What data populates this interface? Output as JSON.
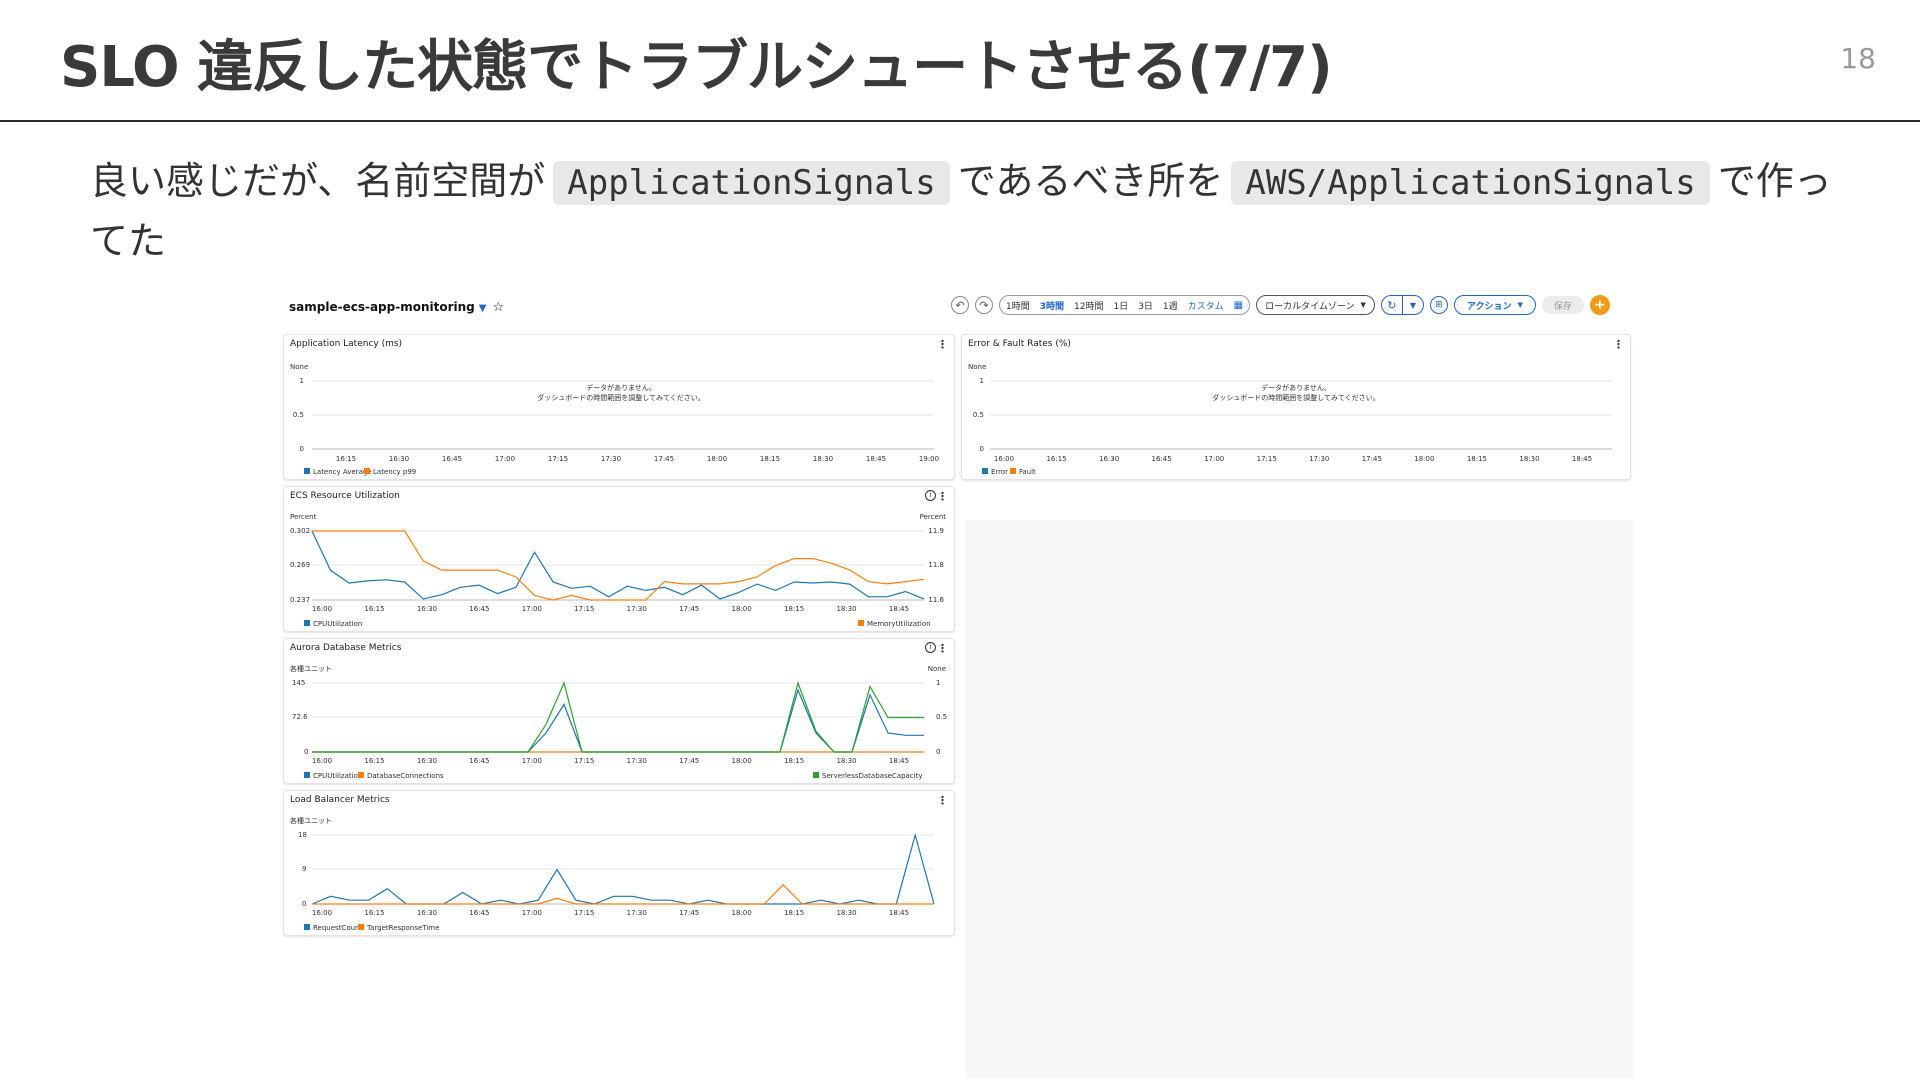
{
  "slide": {
    "title": "SLO 違反した状態でトラブルシュートさせる(7/7)",
    "page_number": "18",
    "text_before_code1": "良い感じだが、名前空間が",
    "code1": "ApplicationSignals",
    "text_between": "であるべき所を",
    "code2": "AWS/ApplicationSignals",
    "text_after": "で作ってた"
  },
  "dashboard": {
    "name": "sample-ecs-app-monitoring",
    "caret": "▼",
    "star": "☆",
    "undo_icon": "undo-icon",
    "redo_icon": "redo-icon",
    "time_ranges": [
      "1時間",
      "3時間",
      "12時間",
      "1日",
      "3日",
      "1週",
      "カスタム"
    ],
    "active_range": "3時間",
    "timezone": "ローカルタイムゾーン",
    "actions_label": "アクション",
    "save_label": "保存",
    "add_label": "+",
    "colors": {
      "blue": "#1f77b4",
      "orange": "#ff7f0e",
      "green": "#2ca02c",
      "accent": "#1f66c9",
      "add": "#f29b16"
    }
  },
  "widgets": {
    "latency": {
      "title": "Application Latency (ms)",
      "unit": "None",
      "y_ticks": [
        "1",
        "0.5",
        "0"
      ],
      "x_ticks": [
        "16:15",
        "16:30",
        "16:45",
        "17:00",
        "17:15",
        "17:30",
        "17:45",
        "18:00",
        "18:15",
        "18:30",
        "18:45",
        "19:00"
      ],
      "empty_line1": "データがありません。",
      "empty_line2": "ダッシュボードの時間範囲を調整してみてください。",
      "legend": [
        "Latency Average",
        "Latency p99"
      ]
    },
    "errors": {
      "title": "Error & Fault Rates (%)",
      "unit": "None",
      "y_ticks": [
        "1",
        "0.5",
        "0"
      ],
      "x_ticks": [
        "16:00",
        "16:15",
        "16:30",
        "16:45",
        "17:00",
        "17:15",
        "17:30",
        "17:45",
        "18:00",
        "18:15",
        "18:30",
        "18:45"
      ],
      "empty_line1": "データがありません。",
      "empty_line2": "ダッシュボードの時間範囲を調整してみてください。",
      "legend": [
        "Error",
        "Fault"
      ]
    },
    "ecs": {
      "title": "ECS Resource Utilization",
      "left_unit": "Percent",
      "right_unit": "Percent",
      "y_ticks_left": [
        "0.302",
        "0.269",
        "0.237"
      ],
      "y_ticks_right": [
        "11.9",
        "11.8",
        "11.6"
      ],
      "x_ticks": [
        "16:00",
        "16:15",
        "16:30",
        "16:45",
        "17:00",
        "17:15",
        "17:30",
        "17:45",
        "18:00",
        "18:15",
        "18:30",
        "18:45"
      ],
      "legend_left": "CPUUtilization",
      "legend_right": "MemoryUtilization"
    },
    "aurora": {
      "title": "Aurora Database Metrics",
      "left_unit": "各種ユニット",
      "right_unit": "None",
      "y_ticks_left": [
        "145",
        "72.6",
        "0"
      ],
      "y_ticks_right": [
        "1",
        "0.5",
        "0"
      ],
      "x_ticks": [
        "16:00",
        "16:15",
        "16:30",
        "16:45",
        "17:00",
        "17:15",
        "17:30",
        "17:45",
        "18:00",
        "18:15",
        "18:30",
        "18:45"
      ],
      "legend_left": [
        "CPUUtilization",
        "DatabaseConnections"
      ],
      "legend_right": "ServerlessDatabaseCapacity"
    },
    "lb": {
      "title": "Load Balancer Metrics",
      "left_unit": "各種ユニット",
      "y_ticks": [
        "18",
        "9",
        "0"
      ],
      "x_ticks": [
        "16:00",
        "16:15",
        "16:30",
        "16:45",
        "17:00",
        "17:15",
        "17:30",
        "17:45",
        "18:00",
        "18:15",
        "18:30",
        "18:45"
      ],
      "legend": [
        "RequestCount",
        "TargetResponseTime"
      ]
    }
  },
  "chart_data": [
    {
      "type": "line",
      "title": "ECS Resource Utilization",
      "x": [
        "16:00",
        "16:05",
        "16:10",
        "16:15",
        "16:20",
        "16:25",
        "16:30",
        "16:35",
        "16:40",
        "16:45",
        "16:50",
        "16:55",
        "17:00",
        "17:05",
        "17:10",
        "17:15",
        "17:20",
        "17:25",
        "17:30",
        "17:35",
        "17:40",
        "17:45",
        "17:50",
        "17:55",
        "18:00",
        "18:05",
        "18:10",
        "18:15",
        "18:20",
        "18:25",
        "18:30",
        "18:35",
        "18:40",
        "18:45"
      ],
      "series": [
        {
          "name": "CPUUtilization",
          "axis": "left",
          "values": [
            0.302,
            0.265,
            0.253,
            0.255,
            0.256,
            0.254,
            0.238,
            0.242,
            0.249,
            0.251,
            0.243,
            0.249,
            0.282,
            0.254,
            0.248,
            0.25,
            0.24,
            0.25,
            0.246,
            0.249,
            0.242,
            0.251,
            0.238,
            0.244,
            0.252,
            0.246,
            0.254,
            0.253,
            0.254,
            0.252,
            0.24,
            0.24,
            0.245,
            0.238
          ]
        },
        {
          "name": "MemoryUtilization",
          "axis": "right",
          "values": [
            11.9,
            11.9,
            11.9,
            11.9,
            11.9,
            11.9,
            11.77,
            11.73,
            11.73,
            11.73,
            11.73,
            11.7,
            11.62,
            11.6,
            11.62,
            11.6,
            11.6,
            11.6,
            11.6,
            11.68,
            11.67,
            11.67,
            11.67,
            11.68,
            11.7,
            11.75,
            11.78,
            11.78,
            11.76,
            11.73,
            11.68,
            11.67,
            11.68,
            11.69
          ]
        }
      ],
      "ylim_left": [
        0.237,
        0.302
      ],
      "ylim_right": [
        11.6,
        11.9
      ]
    },
    {
      "type": "line",
      "title": "Aurora Database Metrics",
      "x": [
        "16:00",
        "16:05",
        "16:10",
        "16:15",
        "16:20",
        "16:25",
        "16:30",
        "16:35",
        "16:40",
        "16:45",
        "16:50",
        "16:55",
        "17:00",
        "17:05",
        "17:10",
        "17:15",
        "17:20",
        "17:25",
        "17:30",
        "17:35",
        "17:40",
        "17:45",
        "17:50",
        "17:55",
        "18:00",
        "18:05",
        "18:10",
        "18:15",
        "18:20",
        "18:25",
        "18:30",
        "18:35",
        "18:40",
        "18:45",
        "18:50"
      ],
      "series": [
        {
          "name": "CPUUtilization",
          "axis": "left",
          "values": [
            0,
            0,
            0,
            0,
            0,
            0,
            0,
            0,
            0,
            0,
            0,
            0,
            0,
            40,
            100,
            0,
            0,
            0,
            0,
            0,
            0,
            0,
            0,
            0,
            0,
            0,
            0,
            130,
            40,
            0,
            0,
            120,
            40,
            35,
            35
          ]
        },
        {
          "name": "DatabaseConnections",
          "axis": "left",
          "values": [
            0,
            0,
            0,
            0,
            0,
            0,
            0,
            0,
            0,
            0,
            0,
            0,
            0,
            0,
            0,
            0,
            0,
            0,
            0,
            0,
            0,
            0,
            0,
            0,
            0,
            0,
            0,
            0,
            0,
            0,
            0,
            0,
            0,
            0,
            0
          ]
        },
        {
          "name": "ServerlessDatabaseCapacity",
          "axis": "right",
          "values": [
            0,
            0,
            0,
            0,
            0,
            0,
            0,
            0,
            0,
            0,
            0,
            0,
            0,
            0.4,
            1.0,
            0,
            0,
            0,
            0,
            0,
            0,
            0,
            0,
            0,
            0,
            0,
            0,
            1.0,
            0.3,
            0,
            0,
            0.95,
            0.5,
            0.5,
            0.5
          ]
        }
      ],
      "ylim_left": [
        0,
        145
      ],
      "ylim_right": [
        0,
        1
      ]
    },
    {
      "type": "line",
      "title": "Load Balancer Metrics",
      "x": [
        "16:00",
        "16:05",
        "16:10",
        "16:15",
        "16:20",
        "16:25",
        "16:30",
        "16:35",
        "16:40",
        "16:45",
        "16:50",
        "16:55",
        "17:00",
        "17:05",
        "17:10",
        "17:15",
        "17:20",
        "17:25",
        "17:30",
        "17:35",
        "17:40",
        "17:45",
        "17:50",
        "17:55",
        "18:00",
        "18:05",
        "18:10",
        "18:15",
        "18:20",
        "18:25",
        "18:30",
        "18:35",
        "18:40",
        "18:45"
      ],
      "series": [
        {
          "name": "RequestCount",
          "values": [
            0,
            2,
            1,
            1,
            4,
            0,
            0,
            0,
            3,
            0,
            1,
            0,
            1,
            9,
            1,
            0,
            2,
            2,
            1,
            1,
            0,
            1,
            0,
            0,
            0,
            0,
            0,
            1,
            0,
            1,
            0,
            0,
            18,
            0
          ]
        },
        {
          "name": "TargetResponseTime",
          "values": [
            0,
            0,
            0,
            0,
            0,
            0,
            0,
            0,
            0,
            0,
            0,
            0,
            0,
            1.5,
            0,
            0,
            0,
            0,
            0,
            0,
            0,
            0,
            0,
            0,
            0,
            5,
            0,
            0,
            0,
            0,
            0,
            0,
            0,
            0
          ]
        }
      ],
      "ylim": [
        0,
        18
      ]
    }
  ]
}
